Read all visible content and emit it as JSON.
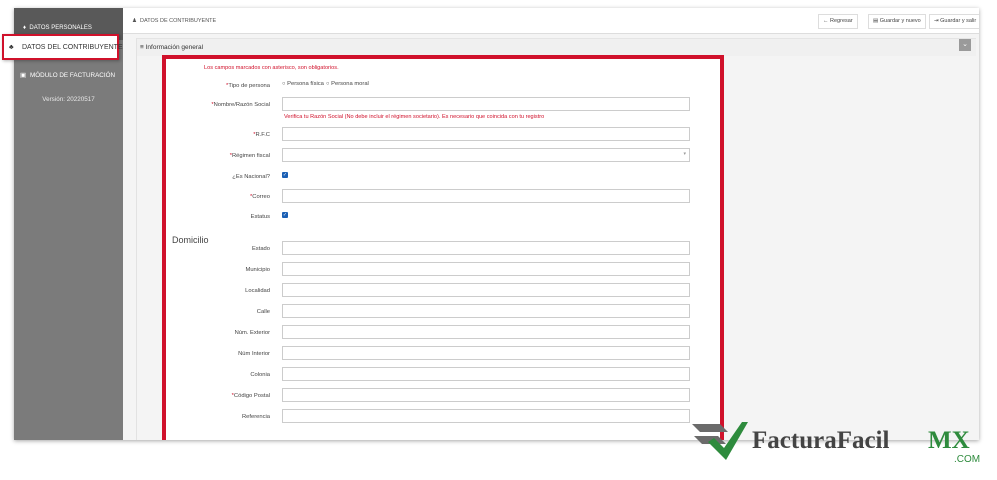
{
  "sidebar": {
    "top_label": "DATOS PERSONALES",
    "active_item": "DATOS DEL CONTRIBUYENTE",
    "billing_item": "MÓDULO DE FACTURACIÓN",
    "version": "Versión: 20220517"
  },
  "topbar": {
    "breadcrumb": "DATOS DE CONTRIBUYENTE",
    "back": "Regresar",
    "save_new": "Guardar y nuevo",
    "save_exit": "Guardar y salir"
  },
  "panel": {
    "title": "Información general"
  },
  "form": {
    "required_note": "Los campos marcados con asterisco, son obligatorios.",
    "tipo_persona": "Tipo de persona",
    "persona_fisica": "Persona física",
    "persona_moral": "Persona moral",
    "nombre": "Nombre/Razón Social",
    "nombre_note": "Verifica tu Razón Social (No debe incluir el régimen societario). Es necesario que coincida con tu registro",
    "rfc": "R.F.C",
    "regimen": "Régimen fiscal",
    "nacional": "¿Es Nacional?",
    "correo": "Correo",
    "estatus": "Estatus"
  },
  "domicilio": {
    "title": "Domicilio",
    "estado": "Estado",
    "municipio": "Municipio",
    "localidad": "Localidad",
    "calle": "Calle",
    "num_exterior": "Núm. Exterior",
    "num_interior": "Núm Interior",
    "colonia": "Colonia",
    "codigo_postal": "Código Postal",
    "referencia": "Referencia"
  },
  "logo": {
    "text": "FacturaFacil",
    "suffix": "MX",
    "domain": ".COM"
  },
  "colors": {
    "accent_red": "#d0112b",
    "sidebar": "#7b7b7b",
    "logo_green": "#2e8b3d"
  }
}
